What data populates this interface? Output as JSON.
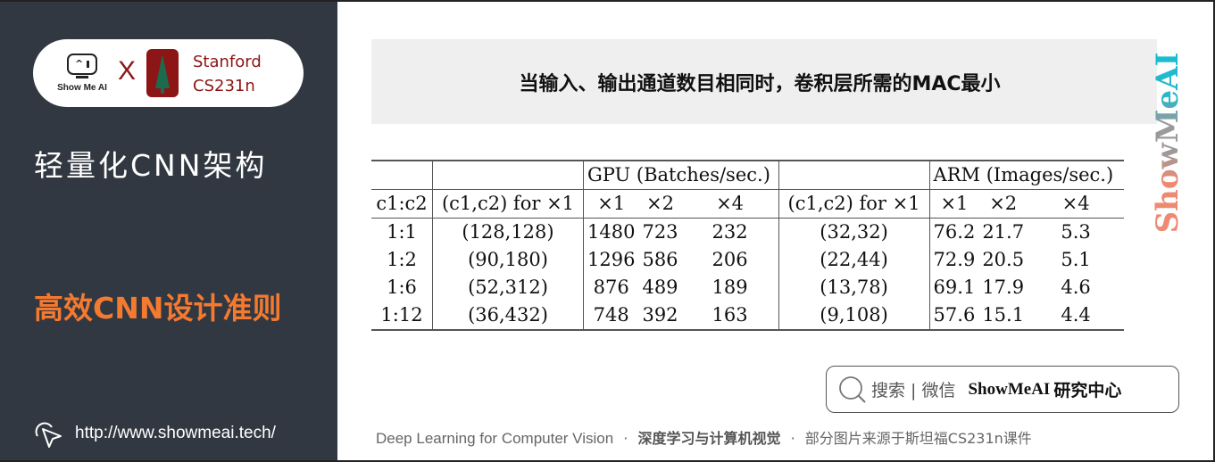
{
  "sidebar": {
    "logo": {
      "showmeai_text": "Show Me AI",
      "cross": "X",
      "stanford_line1": "Stanford",
      "stanford_line2": "CS231n"
    },
    "course_title": "轻量化CNN架构",
    "section_title": "高效CNN设计准则",
    "site_url": "http://www.showmeai.tech/",
    "colors": {
      "background": "#323841",
      "accent": "#f47a30",
      "stanford_red": "#8c1515"
    }
  },
  "main": {
    "banner_text": "当输入、输出通道数目相同时，卷积层所需的MAC最小",
    "watermark": "ShowMeAI",
    "table": {
      "group_headers": [
        "",
        "",
        "GPU (Batches/sec.)",
        "",
        "ARM (Images/sec.)"
      ],
      "column_headers": [
        "c1:c2",
        "(c1,c2) for ×1",
        "×1",
        "×2",
        "×4",
        "(c1,c2) for ×1",
        "×1",
        "×2",
        "×4"
      ],
      "rows": [
        [
          "1:1",
          "(128,128)",
          "1480",
          "723",
          "232",
          "(32,32)",
          "76.2",
          "21.7",
          "5.3"
        ],
        [
          "1:2",
          "(90,180)",
          "1296",
          "586",
          "206",
          "(22,44)",
          "72.9",
          "20.5",
          "5.1"
        ],
        [
          "1:6",
          "(52,312)",
          "876",
          "489",
          "189",
          "(13,78)",
          "69.1",
          "17.9",
          "4.6"
        ],
        [
          "1:12",
          "(36,432)",
          "748",
          "392",
          "163",
          "(9,108)",
          "57.6",
          "15.1",
          "4.4"
        ]
      ]
    },
    "search": {
      "label": "搜索 | 微信",
      "brand": "ShowMeAI",
      "brand_cn": "研究中心"
    },
    "footer": {
      "en": "Deep Learning for Computer Vision",
      "sep": "·",
      "cn_bold": "深度学习与计算机视觉",
      "source": "部分图片来源于斯坦福CS231n课件"
    }
  }
}
